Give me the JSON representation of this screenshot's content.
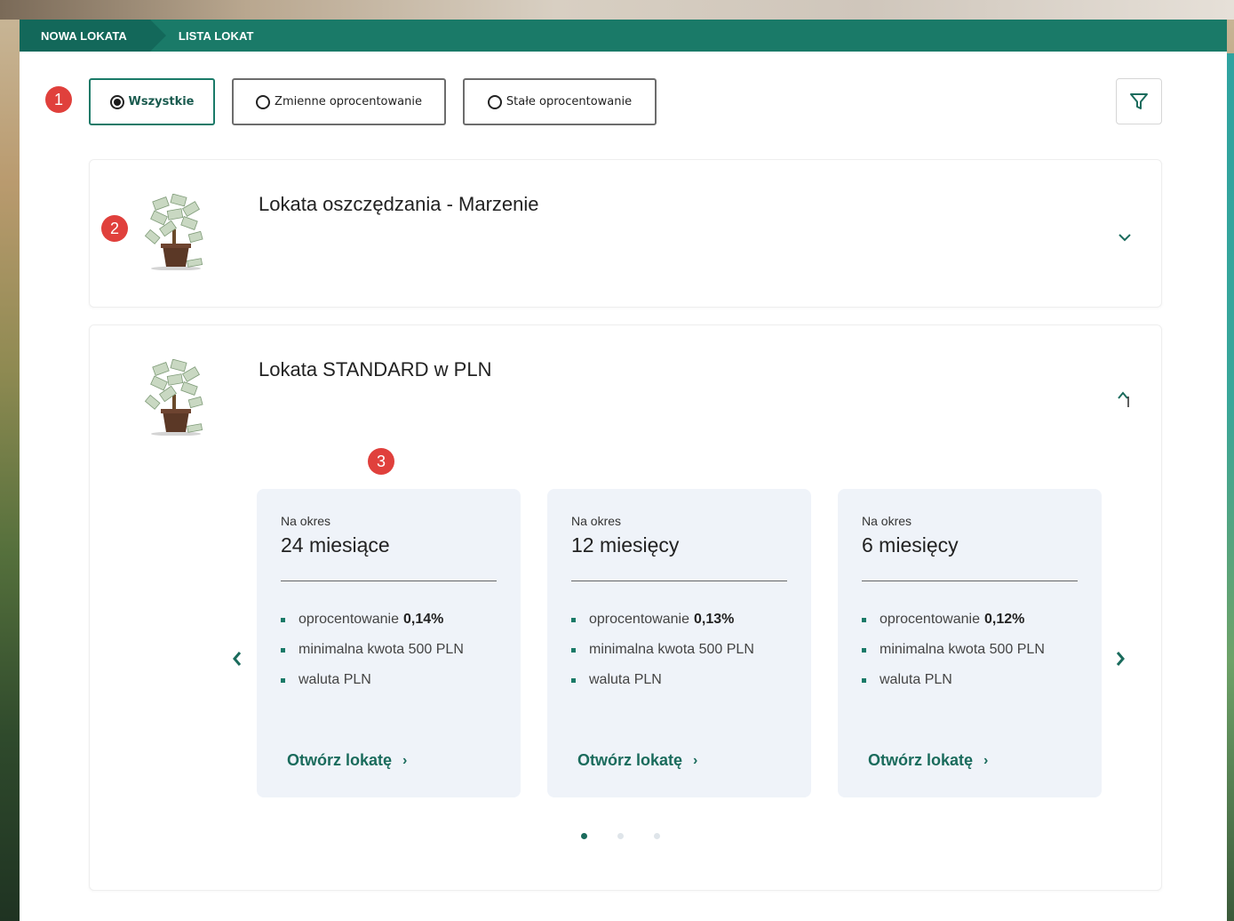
{
  "nav": {
    "tab_new": "NOWA LOKATA",
    "tab_list": "LISTA LOKAT"
  },
  "badges": [
    "1",
    "2",
    "3"
  ],
  "filters": {
    "all": "Wszystkie",
    "variable": "Zmienne oprocentowanie",
    "fixed": "Stałe oprocentowanie",
    "selected": "Wszystkie"
  },
  "deposits": [
    {
      "name": "Lokata oszczędzania - Marzenie",
      "expanded": false
    },
    {
      "name": "Lokata STANDARD w PLN",
      "expanded": true
    }
  ],
  "offers": [
    {
      "period_label": "Na okres",
      "period": "24 miesiące",
      "rate_label": "oprocentowanie",
      "rate": "0,14%",
      "min_amount": "minimalna kwota 500 PLN",
      "currency": "waluta PLN",
      "cta": "Otwórz lokatę"
    },
    {
      "period_label": "Na okres",
      "period": "12 miesięcy",
      "rate_label": "oprocentowanie",
      "rate": "0,13%",
      "min_amount": "minimalna kwota 500 PLN",
      "currency": "waluta PLN",
      "cta": "Otwórz lokatę"
    },
    {
      "period_label": "Na okres",
      "period": "6 miesięcy",
      "rate_label": "oprocentowanie",
      "rate": "0,12%",
      "min_amount": "minimalna kwota 500 PLN",
      "currency": "waluta PLN",
      "cta": "Otwórz lokatę"
    }
  ],
  "carousel": {
    "pages": 3,
    "current": 1
  },
  "icons": {
    "filter": "funnel-icon",
    "expand": "chevron-down-icon",
    "collapse": "chevron-up-icon",
    "prev": "chevron-left-icon",
    "next": "chevron-right-icon",
    "product": "money-plant-icon"
  },
  "colors": {
    "brand": "#1a7a68",
    "badge": "#e0403c",
    "offer_bg": "#eff3f9"
  }
}
